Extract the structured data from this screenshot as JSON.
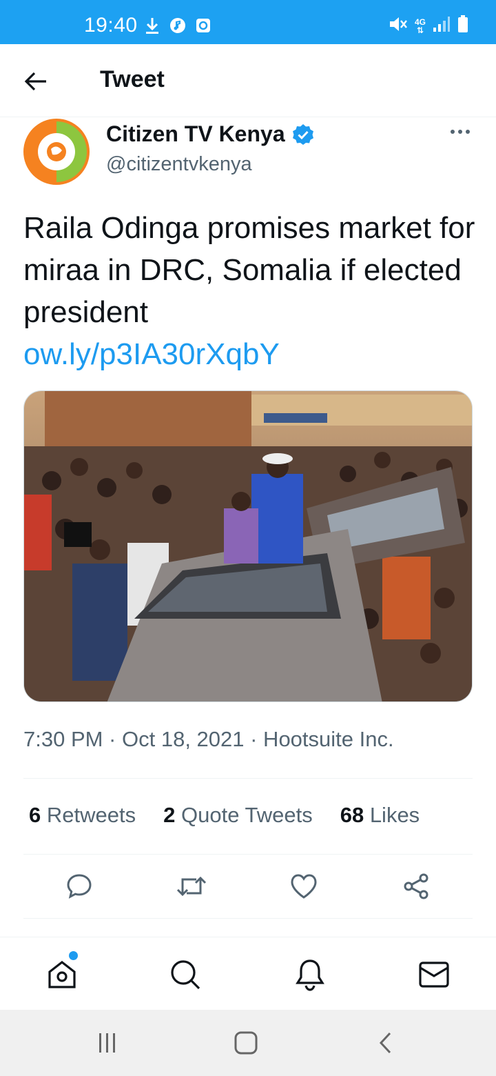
{
  "status_bar": {
    "time": "19:40",
    "network": "4G",
    "background_color": "#1da1f2",
    "icons": [
      "download-icon",
      "music-icon",
      "screen-record-icon",
      "mute-icon",
      "signal-icon",
      "battery-icon"
    ]
  },
  "header": {
    "title": "Tweet",
    "back_icon": "arrow-left-icon"
  },
  "tweet": {
    "author": {
      "name": "Citizen TV Kenya",
      "handle": "@citizentvkenya",
      "verified": true,
      "avatar_colors": [
        "#f58220",
        "#8dc63f"
      ]
    },
    "text": "Raila Odinga promises market for miraa in DRC, Somalia if elected president",
    "link": "ow.ly/p3IA30rXqbY",
    "timestamp": "7:30 PM · Oct 18, 2021 · Hootsuite Inc.",
    "stats": [
      {
        "count": "6",
        "label": "Retweets"
      },
      {
        "count": "2",
        "label": "Quote Tweets"
      },
      {
        "count": "68",
        "label": "Likes"
      }
    ],
    "actions": [
      "reply-icon",
      "retweet-icon",
      "like-icon",
      "share-icon"
    ]
  },
  "bottom_nav": {
    "items": [
      "home-icon",
      "search-icon",
      "notifications-icon",
      "messages-icon"
    ],
    "home_has_new": true
  },
  "system_nav": [
    "recent-apps-icon",
    "home-button-icon",
    "back-button-icon"
  ],
  "colors": {
    "accent": "#1d9bf0",
    "text_primary": "#0f1419",
    "text_secondary": "#536471"
  }
}
